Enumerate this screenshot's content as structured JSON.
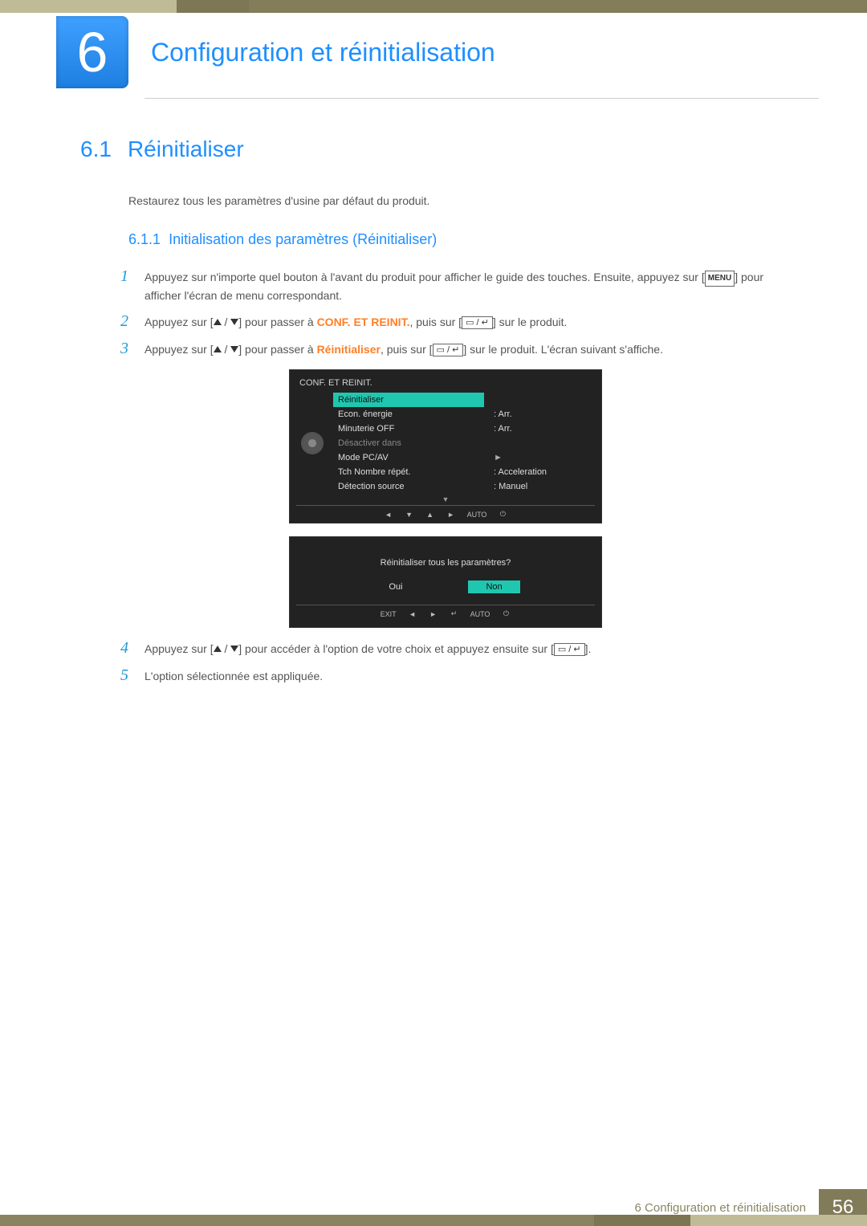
{
  "chapter": {
    "number": "6",
    "title": "Configuration et réinitialisation"
  },
  "section": {
    "number": "6.1",
    "title": "Réinitialiser",
    "lead": "Restaurez tous les paramètres d'usine par défaut du produit."
  },
  "subsection": {
    "number": "6.1.1",
    "title": "Initialisation des paramètres (Réinitialiser)"
  },
  "steps": {
    "s1a": "Appuyez sur n'importe quel bouton à l'avant du produit pour afficher le guide des touches. Ensuite, appuyez sur [",
    "s1b": "] pour afficher l'écran de menu correspondant.",
    "menu_btn": "MENU",
    "s2a": "Appuyez sur [",
    "s2b": "] pour passer à ",
    "conf": "CONF. ET REINIT.",
    "s2c": ", puis sur [",
    "s2d": "] sur le produit.",
    "s3a": "Appuyez sur [",
    "s3b": "] pour passer à ",
    "reinit": "Réinitialiser",
    "s3c": ", puis sur [",
    "s3d": "] sur le produit. L'écran suivant s'affiche.",
    "s4a": "Appuyez sur [",
    "s4b": "] pour accéder à l'option de votre choix et appuyez ensuite sur [",
    "s4c": "].",
    "s5": "L'option sélectionnée est appliquée."
  },
  "osd1": {
    "title": "CONF. ET REINIT.",
    "items": [
      {
        "label": "Réinitialiser",
        "value": "",
        "sel": true
      },
      {
        "label": "Econ. énergie",
        "value": "Arr."
      },
      {
        "label": "Minuterie OFF",
        "value": "Arr."
      },
      {
        "label": "Désactiver dans",
        "value": "",
        "dim": true
      },
      {
        "label": "Mode PC/AV",
        "value": "►"
      },
      {
        "label": "Tch Nombre répét.",
        "value": "Acceleration"
      },
      {
        "label": "Détection source",
        "value": "Manuel"
      }
    ],
    "footer": [
      "◄",
      "▼",
      "▲",
      "►",
      "AUTO",
      "⏻"
    ]
  },
  "osd2": {
    "question": "Réinitialiser tous les paramètres?",
    "yes": "Oui",
    "no": "Non",
    "footer": [
      "EXIT",
      "◄",
      "►",
      "↵",
      "AUTO",
      "⏻"
    ]
  },
  "footer": {
    "text": "6 Configuration et réinitialisation",
    "page": "56"
  }
}
